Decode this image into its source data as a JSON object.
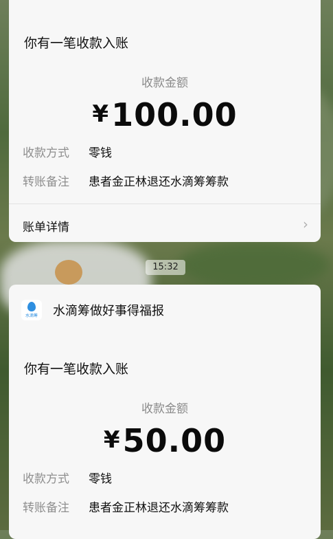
{
  "message1": {
    "title": "你有一笔收款入账",
    "amount_label": "收款金额",
    "currency": "¥",
    "amount": "100.00",
    "method_label": "收款方式",
    "method_value": "零钱",
    "note_label": "转账备注",
    "note_value": "患者金正林退还水滴筹筹款",
    "details_link": "账单详情",
    "details_icon": "chevron-right-icon"
  },
  "timestamp": "15:32",
  "message2": {
    "sender_logo_text": "水滴筹",
    "sender_logo_icon": "water-drop-icon",
    "sender_name": "水滴筹做好事得福报",
    "title": "你有一笔收款入账",
    "amount_label": "收款金额",
    "currency": "¥",
    "amount": "50.00",
    "method_label": "收款方式",
    "method_value": "零钱",
    "note_label": "转账备注",
    "note_value": "患者金正林退还水滴筹筹款"
  },
  "colors": {
    "card_bg": "#f7f7f7",
    "label_gray": "#8e8e8e",
    "brand_blue": "#2f8fe0"
  }
}
